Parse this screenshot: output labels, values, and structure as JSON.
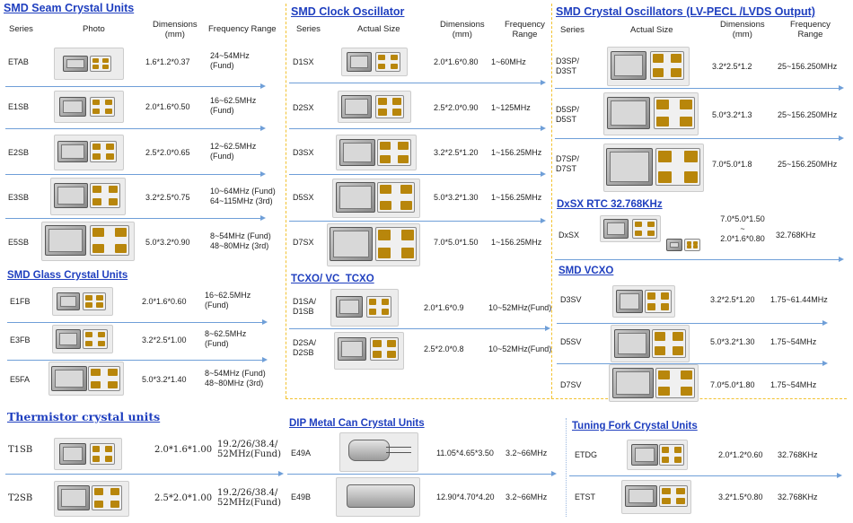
{
  "seam": {
    "title": "SMD Seam Crystal Units",
    "h_series": "Series",
    "h_photo": "Photo",
    "h_dim": "Dimensions\n(mm)",
    "h_freq": "Frequency Range",
    "rows": [
      {
        "series": "ETAB",
        "dim": "1.6*1.2*0.37",
        "freq": "24~54MHz\n(Fund)"
      },
      {
        "series": "E1SB",
        "dim": "2.0*1.6*0.50",
        "freq": "16~62.5MHz\n(Fund)"
      },
      {
        "series": "E2SB",
        "dim": "2.5*2.0*0.65",
        "freq": "12~62.5MHz\n(Fund)"
      },
      {
        "series": "E3SB",
        "dim": "3.2*2.5*0.75",
        "freq": "10~64MHz (Fund)\n64~115MHz (3rd)"
      },
      {
        "series": "E5SB",
        "dim": "5.0*3.2*0.90",
        "freq": "8~54MHz (Fund)\n48~80MHz (3rd)"
      }
    ]
  },
  "glass": {
    "title": "SMD Glass Crystal Units",
    "rows": [
      {
        "series": "E1FB",
        "dim": "2.0*1.6*0.60",
        "freq": "16~62.5MHz\n(Fund)"
      },
      {
        "series": "E3FB",
        "dim": "3.2*2.5*1.00",
        "freq": "8~62.5MHz\n(Fund)"
      },
      {
        "series": "E5FA",
        "dim": "5.0*3.2*1.40",
        "freq": "8~54MHz (Fund)\n48~80MHz (3rd)"
      }
    ]
  },
  "therm": {
    "title": "Thermistor crystal units",
    "rows": [
      {
        "series": "T1SB",
        "dim": "2.0*1.6*1.00",
        "freq": "19.2/26/38.4/\n52MHz(Fund)"
      },
      {
        "series": "T2SB",
        "dim": "2.5*2.0*1.00",
        "freq": "19.2/26/38.4/\n52MHz(Fund)"
      }
    ]
  },
  "clock": {
    "title": "SMD Clock Oscillator",
    "h_series": "Series",
    "h_size": "Actual Size",
    "h_dim": "Dimensions\n(mm)",
    "h_freq": "Frequency\nRange",
    "rows": [
      {
        "series": "D1SX",
        "dim": "2.0*1.6*0.80",
        "freq": "1~60MHz"
      },
      {
        "series": "D2SX",
        "dim": "2.5*2.0*0.90",
        "freq": "1~125MHz"
      },
      {
        "series": "D3SX",
        "dim": "3.2*2.5*1.20",
        "freq": "1~156.25MHz"
      },
      {
        "series": "D5SX",
        "dim": "5.0*3.2*1.30",
        "freq": "1~156.25MHz"
      },
      {
        "series": "D7SX",
        "dim": "7.0*5.0*1.50",
        "freq": "1~156.25MHz"
      }
    ]
  },
  "tcxo": {
    "title": "TCXO/ VC_TCXO",
    "rows": [
      {
        "series": "D1SA/\nD1SB",
        "dim": "2.0*1.6*0.9",
        "freq": "10~52MHz(Fund)"
      },
      {
        "series": "D2SA/\nD2SB",
        "dim": "2.5*2.0*0.8",
        "freq": "10~52MHz(Fund)"
      }
    ]
  },
  "dip": {
    "title": "DIP Metal Can Crystal Units",
    "rows": [
      {
        "series": "E49A",
        "dim": "11.05*4.65*3.50",
        "freq": "3.2~66MHz"
      },
      {
        "series": "E49B",
        "dim": "12.90*4.70*4.20",
        "freq": "3.2~66MHz"
      }
    ]
  },
  "lvpecl": {
    "title": "SMD Crystal Oscillators (LV-PECL /LVDS Output)",
    "h_series": "Series",
    "h_size": "Actual Size",
    "h_dim": "Dimensions\n(mm)",
    "h_freq": "Frequency\nRange",
    "rows": [
      {
        "series": "D3SP/\nD3ST",
        "dim": "3.2*2.5*1.2",
        "freq": "25~156.250MHz"
      },
      {
        "series": "D5SP/\nD5ST",
        "dim": "5.0*3.2*1.3",
        "freq": "25~156.250MHz"
      },
      {
        "series": "D7SP/\nD7ST",
        "dim": "7.0*5.0*1.8",
        "freq": "25~156.250MHz"
      }
    ]
  },
  "rtc": {
    "title": "DxSX RTC 32.768KHz",
    "series": "DxSX",
    "dim": "7.0*5.0*1.50\n~\n2.0*1.6*0.80",
    "freq": "32.768KHz"
  },
  "vcxo": {
    "title": "SMD VCXO",
    "rows": [
      {
        "series": "D3SV",
        "dim": "3.2*2.5*1.20",
        "freq": "1.75~61.44MHz"
      },
      {
        "series": "D5SV",
        "dim": "5.0*3.2*1.30",
        "freq": "1.75~54MHz"
      },
      {
        "series": "D7SV",
        "dim": "7.0*5.0*1.80",
        "freq": "1.75~54MHz"
      }
    ]
  },
  "tuning": {
    "title": "Tuning Fork Crystal Units",
    "rows": [
      {
        "series": "ETDG",
        "dim": "2.0*1.2*0.60",
        "freq": "32.768KHz"
      },
      {
        "series": "ETST",
        "dim": "3.2*1.5*0.80",
        "freq": "32.768KHz"
      }
    ]
  }
}
